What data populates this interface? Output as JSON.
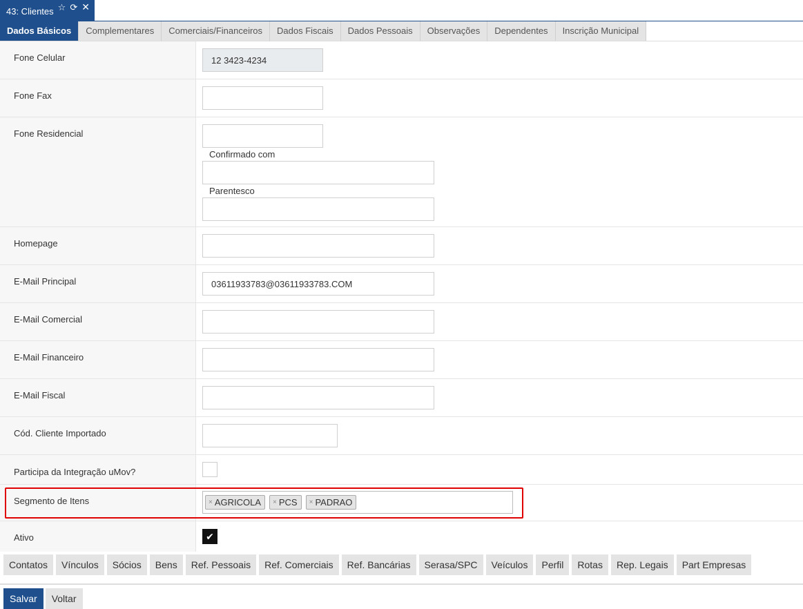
{
  "window": {
    "title": "43: Clientes",
    "icons": {
      "favorite": "☆",
      "refresh": "⟳",
      "close": "✕"
    }
  },
  "tabs": [
    {
      "label": "Dados Básicos",
      "active": true
    },
    {
      "label": "Complementares"
    },
    {
      "label": "Comerciais/Financeiros"
    },
    {
      "label": "Dados Fiscais"
    },
    {
      "label": "Dados Pessoais"
    },
    {
      "label": "Observações"
    },
    {
      "label": "Dependentes"
    },
    {
      "label": "Inscrição Municipal"
    }
  ],
  "form": {
    "fone_celular": {
      "label": "Fone Celular",
      "value": "12 3423-4234"
    },
    "fone_fax": {
      "label": "Fone Fax",
      "value": ""
    },
    "fone_residencial": {
      "label": "Fone Residencial",
      "value": "",
      "confirmado_label": "Confirmado com",
      "confirmado_value": "",
      "parentesco_label": "Parentesco",
      "parentesco_value": ""
    },
    "homepage": {
      "label": "Homepage",
      "value": ""
    },
    "email_principal": {
      "label": "E-Mail Principal",
      "value": "03611933783@03611933783.COM"
    },
    "email_comercial": {
      "label": "E-Mail Comercial",
      "value": ""
    },
    "email_financeiro": {
      "label": "E-Mail Financeiro",
      "value": ""
    },
    "email_fiscal": {
      "label": "E-Mail Fiscal",
      "value": ""
    },
    "cod_cliente_importado": {
      "label": "Cód. Cliente Importado",
      "value": ""
    },
    "integracao_umov": {
      "label": "Participa da Integração uMov?",
      "checked": false
    },
    "segmento_itens": {
      "label": "Segmento de Itens",
      "remove_glyph": "×",
      "tags": [
        "AGRICOLA",
        "PCS",
        "PADRAO"
      ]
    },
    "ativo": {
      "label": "Ativo",
      "checked": true,
      "check_glyph": "✔"
    }
  },
  "subtabs": [
    "Contatos",
    "Vínculos",
    "Sócios",
    "Bens",
    "Ref. Pessoais",
    "Ref. Comerciais",
    "Ref. Bancárias",
    "Serasa/SPC",
    "Veículos",
    "Perfil",
    "Rotas",
    "Rep. Legais",
    "Part Empresas"
  ],
  "actions": {
    "save": "Salvar",
    "back": "Voltar"
  },
  "colors": {
    "accent": "#1f4f8c",
    "highlight": "#e00000"
  }
}
